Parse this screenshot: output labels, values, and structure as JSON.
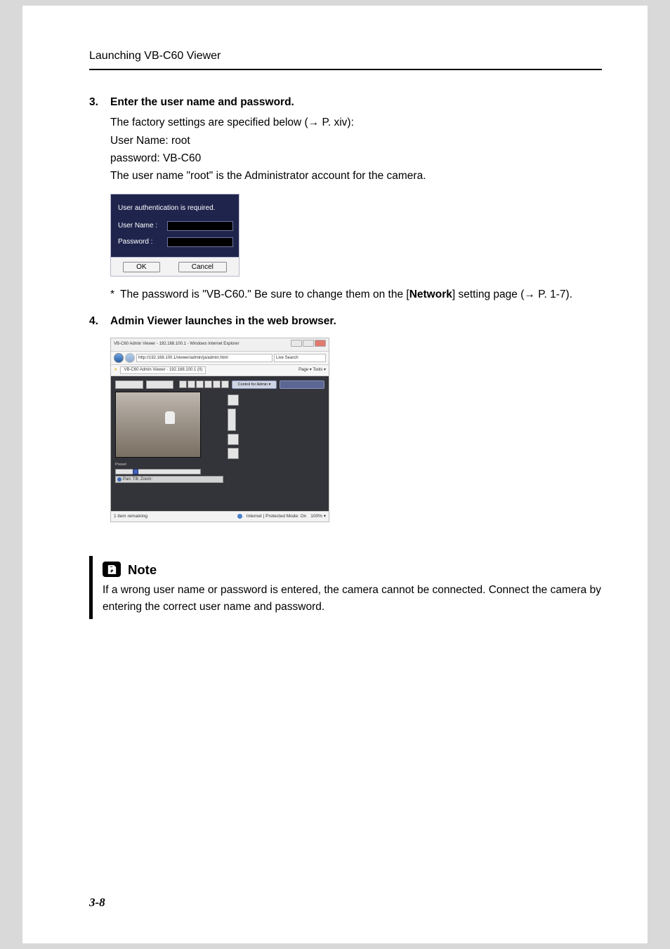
{
  "header": {
    "running": "Launching VB-C60 Viewer"
  },
  "step3": {
    "num": "3.",
    "title": "Enter the user name and password.",
    "p1_a": "The factory settings are specified below (",
    "p1_arrow": "→",
    "p1_b": " P. xiv):",
    "p2": "User Name: root",
    "p3": "password: VB-C60",
    "p4": "The user name \"root\" is the Administrator account for the camera.",
    "footnote_mark": "*",
    "footnote_a": "The password is \"VB-C60.\" Be sure to change them on the [",
    "footnote_bold": "Network",
    "footnote_b_a": "] setting page (",
    "footnote_arrow": "→",
    "footnote_b_b": " P. 1-7)."
  },
  "dialog": {
    "msg": "User authentication is required.",
    "user_label": "User Name :",
    "pass_label": "Password :",
    "ok": "OK",
    "cancel": "Cancel"
  },
  "step4": {
    "num": "4.",
    "title": "Admin Viewer launches in the web browser."
  },
  "browser": {
    "title": "VB-C60 Admin Viewer - 192.168.100.1 - Windows Internet Explorer",
    "url": "http://192.168.100.1/viewer/admin/ja/admin.html",
    "search_ph": "Live Search",
    "tab": "VB-C60 Admin Viewer - 192.168.100.1 (II)",
    "toolbar_right": "Page ▾  Tools ▾",
    "control_label": "Control for Admin ▾",
    "panel_label": "Preset",
    "info": "Pan:  Tilt:  Zoom:",
    "status_left": "1 item remaining",
    "status_mid": "Internet | Protected Mode: On",
    "status_zoom": "100%  ▾"
  },
  "note": {
    "heading": "Note",
    "body": "If a wrong user name or password is entered, the camera cannot be connected. Connect the camera by entering the correct user name and password."
  },
  "pagenum": "3-8"
}
